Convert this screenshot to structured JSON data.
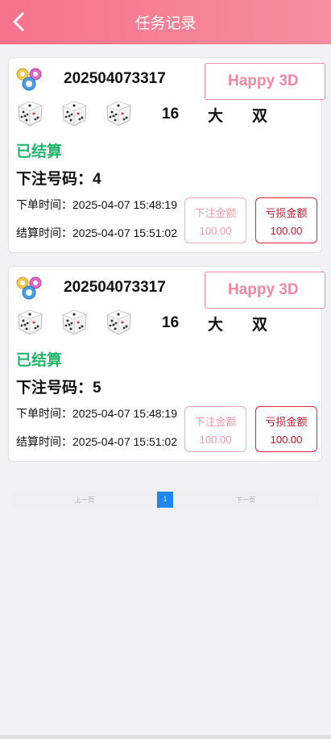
{
  "header": {
    "title": "任务记录"
  },
  "records": [
    {
      "period": "202504073317",
      "game_name": "Happy 3D",
      "sum": "16",
      "big_small": "大",
      "odd_even": "双",
      "status": "已结算",
      "bet_label": "下注号码：",
      "bet_number": "4",
      "order_time_label": "下单时间：",
      "order_time": "2025-04-07 15:48:19",
      "settle_time_label": "结算时间：",
      "settle_time": "2025-04-07 15:51:02",
      "bet_amount_label": "下注金额",
      "bet_amount": "100.00",
      "loss_amount_label": "亏损金额",
      "loss_amount": "100.00"
    },
    {
      "period": "202504073317",
      "game_name": "Happy 3D",
      "sum": "16",
      "big_small": "大",
      "odd_even": "双",
      "status": "已结算",
      "bet_label": "下注号码：",
      "bet_number": "5",
      "order_time_label": "下单时间：",
      "order_time": "2025-04-07 15:48:19",
      "settle_time_label": "结算时间：",
      "settle_time": "2025-04-07 15:51:02",
      "bet_amount_label": "下注金额",
      "bet_amount": "100.00",
      "loss_amount_label": "亏损金额",
      "loss_amount": "100.00"
    }
  ],
  "pagination": {
    "prev_label": "上一页",
    "current_page": "1",
    "next_label": "下一页"
  },
  "icons": {
    "back": "chevron-left-icon",
    "logo": "lottery-balls-icon",
    "dice": "dice-icon"
  },
  "colors": {
    "header_start": "#f7728c",
    "header_end": "#f58ea0",
    "status_green": "#1fb56a",
    "game_pink": "#f08aa0",
    "loss_red": "#c4162c",
    "page_blue": "#1e88ee"
  }
}
